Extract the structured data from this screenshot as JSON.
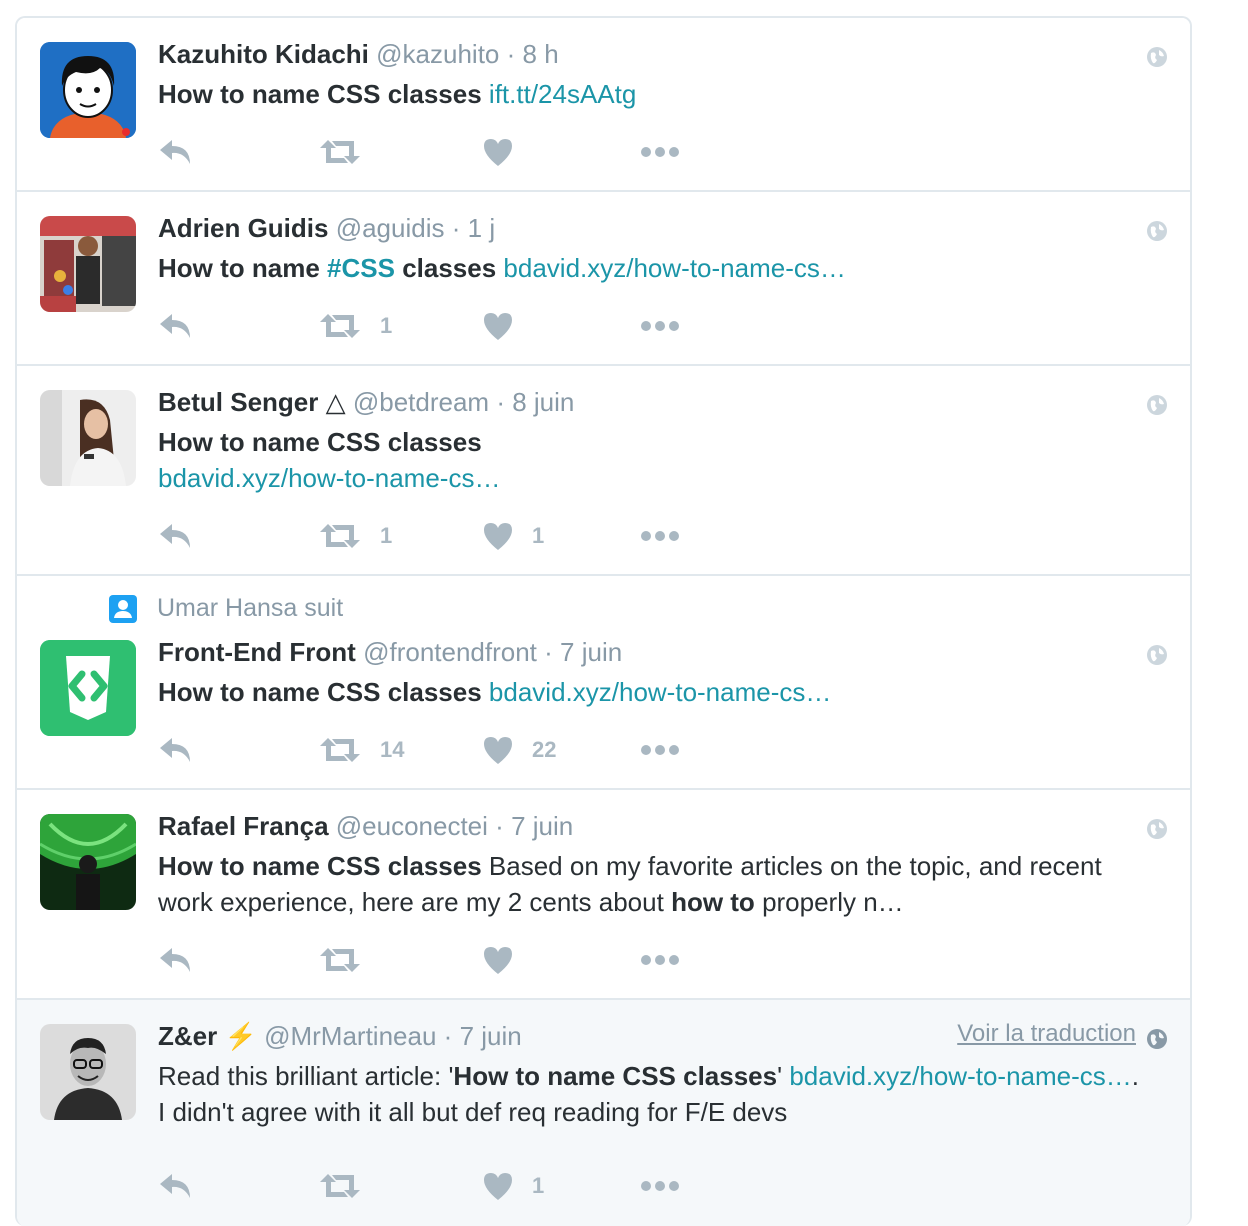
{
  "tweets": [
    {
      "name": "Kazuhito Kidachi",
      "handle": "@kazuhito",
      "sep": "·",
      "time": "8 h",
      "text_bold": "How to name CSS classes",
      "link": "ift.tt/24sAAtg"
    },
    {
      "name": "Adrien Guidis",
      "handle": "@aguidis",
      "sep": "·",
      "time": "1 j",
      "text_bold_a": "How to name",
      "hashtag": "#CSS",
      "text_bold_b": "classes",
      "link": "bdavid.xyz/how-to-name-cs…",
      "retweets": "1"
    },
    {
      "name": "Betul Senger",
      "name_symbol": "△",
      "handle": "@betdream",
      "sep": "·",
      "time": "8 juin",
      "text_bold": "How to name CSS classes",
      "link": "bdavid.xyz/how-to-name-cs…",
      "retweets": "1",
      "likes": "1"
    },
    {
      "social_context": "Umar Hansa suit",
      "name": "Front-End Front",
      "handle": "@frontendfront",
      "sep": "·",
      "time": "7 juin",
      "text_bold": "How to name CSS classes",
      "link": "bdavid.xyz/how-to-name-cs…",
      "retweets": "14",
      "likes": "22"
    },
    {
      "name": "Rafael França",
      "handle": "@euconectei",
      "sep": "·",
      "time": "7 juin",
      "text_bold": "How to name CSS classes",
      "text_rest": "Based on my favorite articles on the topic, and recent work experience, here are my 2 cents about",
      "text_bold_2": "how to",
      "text_end": "properly n…"
    },
    {
      "name": "Z&er",
      "name_emoji": "⚡",
      "handle": "@MrMartineau",
      "sep": "·",
      "time": "7 juin",
      "translate": "Voir la traduction",
      "text_pre": "Read this brilliant article: '",
      "text_bold": "How to name CSS classes",
      "text_quote": "'",
      "link": "bdavid.xyz/how-to-name-cs…",
      "text_end": ". I didn't agree with it all but def req reading for F/E devs",
      "likes": "1"
    }
  ],
  "icons": {
    "reply": "reply-icon",
    "retweet": "retweet-icon",
    "like": "heart-icon",
    "more": "more-icon",
    "globe": "globe-icon",
    "follow": "person-icon"
  },
  "colors": {
    "link": "#1b95a8",
    "muted": "#8899a6",
    "icon": "#aab8c2",
    "border": "#e1e8ed",
    "highlight": "#f5f8fa",
    "brand_green": "#2fbf71"
  }
}
